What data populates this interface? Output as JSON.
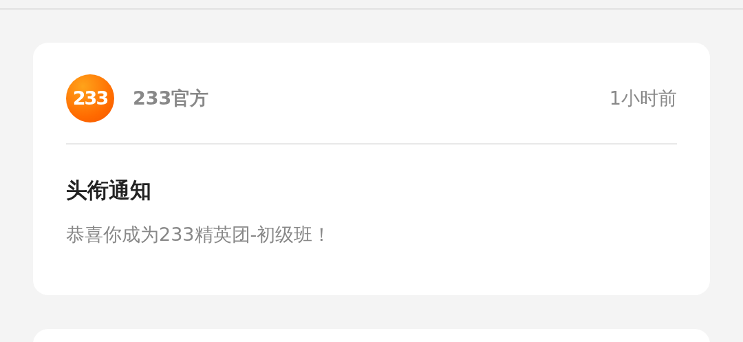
{
  "messages": [
    {
      "avatar_text": "233",
      "sender": "233官方",
      "time": "1小时前",
      "title": "头衔通知",
      "body": "恭喜你成为233精英团-初级班！"
    }
  ]
}
